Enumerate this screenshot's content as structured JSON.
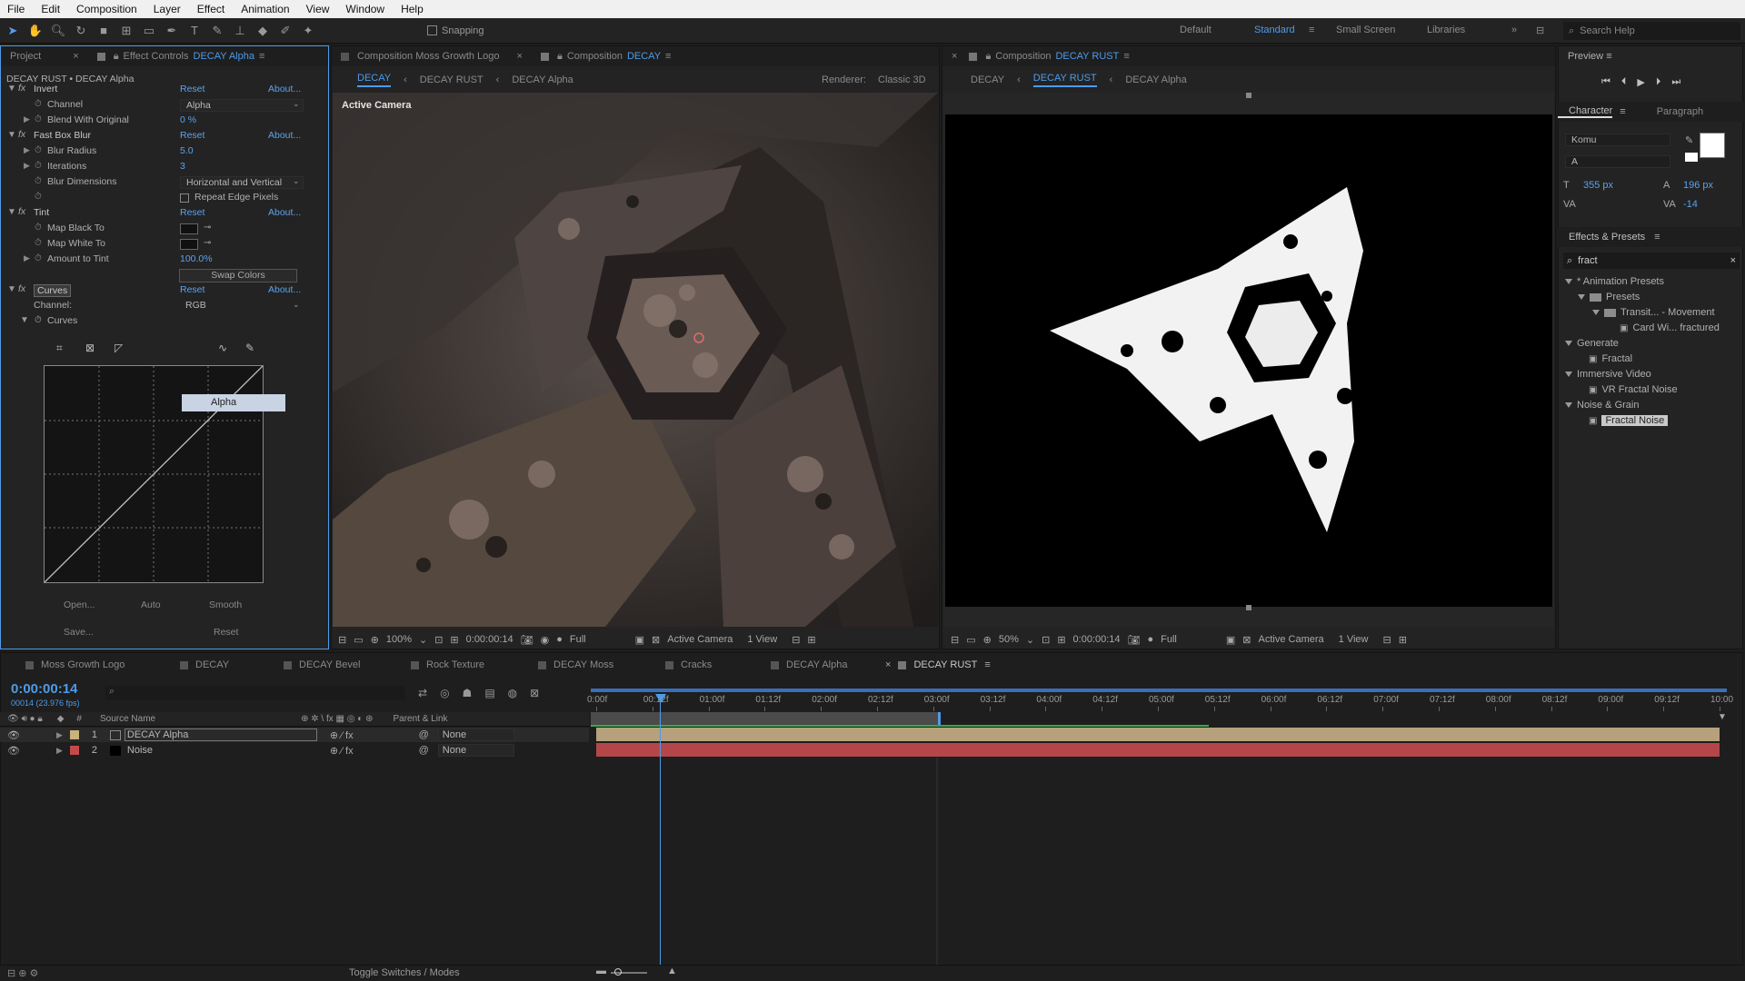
{
  "menu": [
    "File",
    "Edit",
    "Composition",
    "Layer",
    "Effect",
    "Animation",
    "View",
    "Window",
    "Help"
  ],
  "toolbar": {
    "snapping_label": "Snapping",
    "workspaces": [
      "Default",
      "Standard",
      "Small Screen",
      "Libraries"
    ],
    "active_workspace": "Standard",
    "search_placeholder": "Search Help"
  },
  "left_panel": {
    "tab_project": "Project",
    "tab_effect_controls": "Effect Controls",
    "effect_controls_layer": "DECAY Alpha",
    "header": "DECAY RUST • DECAY Alpha",
    "rows": {
      "invert_label": "Invert",
      "reset": "Reset",
      "about": "About...",
      "channel_label": "Channel",
      "channel_value": "Alpha",
      "blend_label": "Blend With Original",
      "blend_value": "0 %",
      "fbb_label": "Fast Box Blur",
      "blur_radius_label": "Blur Radius",
      "blur_radius_value": "5.0",
      "iterations_label": "Iterations",
      "iterations_value": "3",
      "blur_dim_label": "Blur Dimensions",
      "blur_dim_value": "Horizontal and Vertical",
      "repeat_edge_label": "Repeat Edge Pixels",
      "tint_label": "Tint",
      "map_black_label": "Map Black To",
      "map_white_label": "Map White To",
      "amount_tint_label": "Amount to Tint",
      "amount_tint_value": "100.0%",
      "swap_colors": "Swap Colors",
      "curves_label": "Curves",
      "curves_channel_label": "Channel:",
      "curves_channel_value": "RGB",
      "curves_sub_label": "Curves",
      "dropdown_popup": "Alpha",
      "open": "Open...",
      "auto": "Auto",
      "smooth": "Smooth",
      "save": "Save...",
      "reset_btn": "Reset"
    }
  },
  "comp_left": {
    "tab1": "Composition Moss Growth Logo",
    "tab2_prefix": "Composition",
    "tab2_name": "DECAY",
    "crumbs": [
      "DECAY",
      "DECAY RUST",
      "DECAY Alpha"
    ],
    "renderer_label": "Renderer:",
    "renderer_value": "Classic 3D",
    "active_camera_label": "Active Camera",
    "zoom": "100%",
    "timecode": "0:00:00:14",
    "resolution": "Full",
    "camera": "Active Camera",
    "views": "1 View"
  },
  "comp_right": {
    "tab_prefix": "Composition",
    "tab_name": "DECAY RUST",
    "crumbs": [
      "DECAY",
      "DECAY RUST",
      "DECAY Alpha"
    ],
    "zoom": "50%",
    "timecode": "0:00:00:14",
    "resolution": "Full",
    "camera": "Active Camera",
    "views": "1 View"
  },
  "right_panel": {
    "preview": "Preview",
    "character": "Character",
    "paragraph": "Paragraph",
    "font": "Komu",
    "font_style": "A",
    "font_size": "355 px",
    "leading": "196 px",
    "tracking": "-14",
    "effects_presets": "Effects & Presets",
    "search_value": "fract",
    "tree": {
      "animation_presets": "* Animation Presets",
      "presets": "Presets",
      "transit": "Transit... - Movement",
      "card_wi": "Card Wi... fractured",
      "generate": "Generate",
      "fractal": "Fractal",
      "immersive": "Immersive Video",
      "vr_fractal": "VR Fractal Noise",
      "noise_grain": "Noise & Grain",
      "fractal_noise": "Fractal Noise"
    }
  },
  "timeline": {
    "tabs": [
      "Moss Growth Logo",
      "DECAY",
      "DECAY Bevel",
      "Rock Texture",
      "DECAY Moss",
      "Cracks",
      "DECAY Alpha",
      "DECAY RUST"
    ],
    "active_tab": "DECAY RUST",
    "timecode": "0:00:00:14",
    "fps": "00014 (23.976 fps)",
    "col_source": "Source Name",
    "col_parent": "Parent & Link",
    "layers": [
      {
        "num": "1",
        "name": "DECAY Alpha",
        "parent": "None",
        "color": "#c9b27c"
      },
      {
        "num": "2",
        "name": "Noise",
        "parent": "None",
        "color": "#c44a4a"
      }
    ],
    "ruler": [
      "0:00f",
      "00:12f",
      "01:00f",
      "01:12f",
      "02:00f",
      "02:12f",
      "03:00f",
      "03:12f",
      "04:00f",
      "04:12f",
      "05:00f",
      "05:12f",
      "06:00f",
      "06:12f",
      "07:00f",
      "07:12f",
      "08:00f",
      "08:12f",
      "09:00f",
      "09:12f",
      "10:00"
    ],
    "toggle_label": "Toggle Switches / Modes"
  }
}
